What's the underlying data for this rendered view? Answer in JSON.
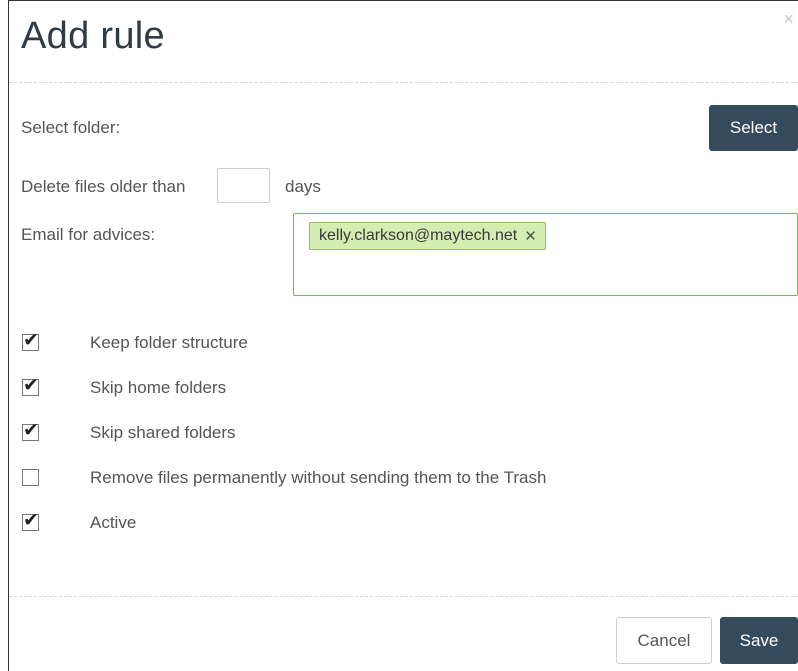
{
  "dialog": {
    "title": "Add rule",
    "close_glyph": "×"
  },
  "form": {
    "select_folder_label": "Select folder:",
    "select_button": "Select",
    "delete_prefix": "Delete files older than",
    "delete_days_value": "",
    "delete_suffix": "days",
    "email_label": "Email for advices:",
    "email_tags": [
      {
        "text": "kelly.clarkson@maytech.net",
        "remove_glyph": "✕"
      }
    ]
  },
  "options": [
    {
      "label": "Keep folder structure",
      "checked": true
    },
    {
      "label": "Skip home folders",
      "checked": true
    },
    {
      "label": "Skip shared folders",
      "checked": true
    },
    {
      "label": "Remove files permanently without sending them to the Trash",
      "checked": false
    },
    {
      "label": "Active",
      "checked": true
    }
  ],
  "footer": {
    "cancel": "Cancel",
    "save": "Save"
  },
  "colors": {
    "primary_button": "#364a5e",
    "email_border": "#75b955",
    "tag_background": "#d4edb1"
  },
  "icons": {
    "check": "check-icon",
    "close": "close-icon",
    "tag_remove": "remove-tag-icon"
  }
}
